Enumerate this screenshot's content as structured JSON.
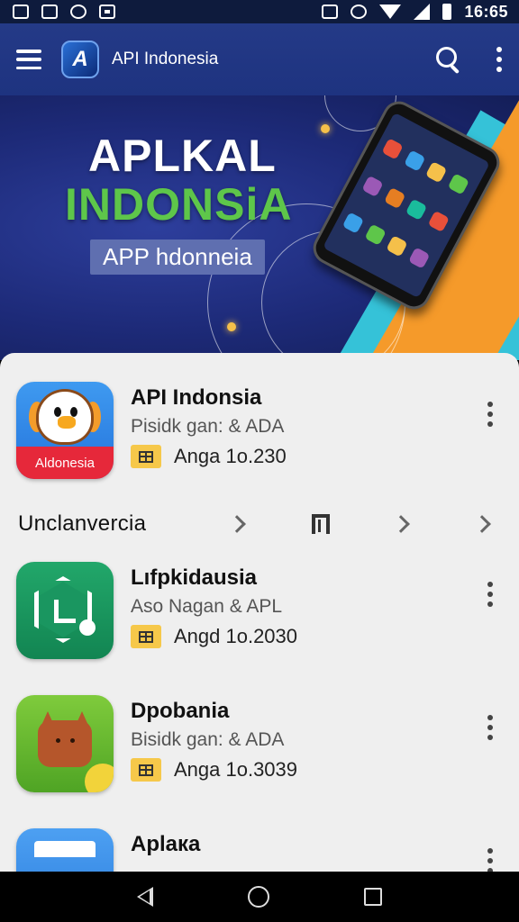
{
  "status_bar": {
    "time": "16:65",
    "left_icons": [
      "photo-icon",
      "s-icon",
      "alarm-icon",
      "square-icon"
    ],
    "right_icons": [
      "vibrate-icon",
      "sync-icon",
      "wifi-icon",
      "signal-icon",
      "battery-icon"
    ]
  },
  "appbar": {
    "title": "API Indonesia",
    "logo_glyph": "A"
  },
  "banner": {
    "line1": "APLKAL",
    "line2": "INDONSiA",
    "pill": "APP hdonneia",
    "colors": {
      "line2": "#5ec64a",
      "orange": "#f59a2a",
      "teal": "#35c2d8"
    }
  },
  "apps": [
    {
      "name": "API Indonsia",
      "subtitle": "Pisidk gan: & ADA",
      "meta": "Anga 1o.230",
      "icon": "bird-icon",
      "icon_label": "Aldonesia"
    },
    {
      "name": "Lıfpkidausia",
      "subtitle": "Aso Nagan & APL",
      "meta": "Angd 1o.2030",
      "icon": "house-icon"
    },
    {
      "name": "Dpobania",
      "subtitle": "Bisidk gan: & ADA",
      "meta": "Anga 1o.3039",
      "icon": "fox-icon"
    },
    {
      "name": "Aplaка",
      "subtitle": "",
      "meta": "",
      "icon": "store-icon"
    }
  ],
  "section": {
    "title": "Unclanvercia"
  },
  "nav": [
    "back-icon",
    "home-icon",
    "recents-icon"
  ]
}
